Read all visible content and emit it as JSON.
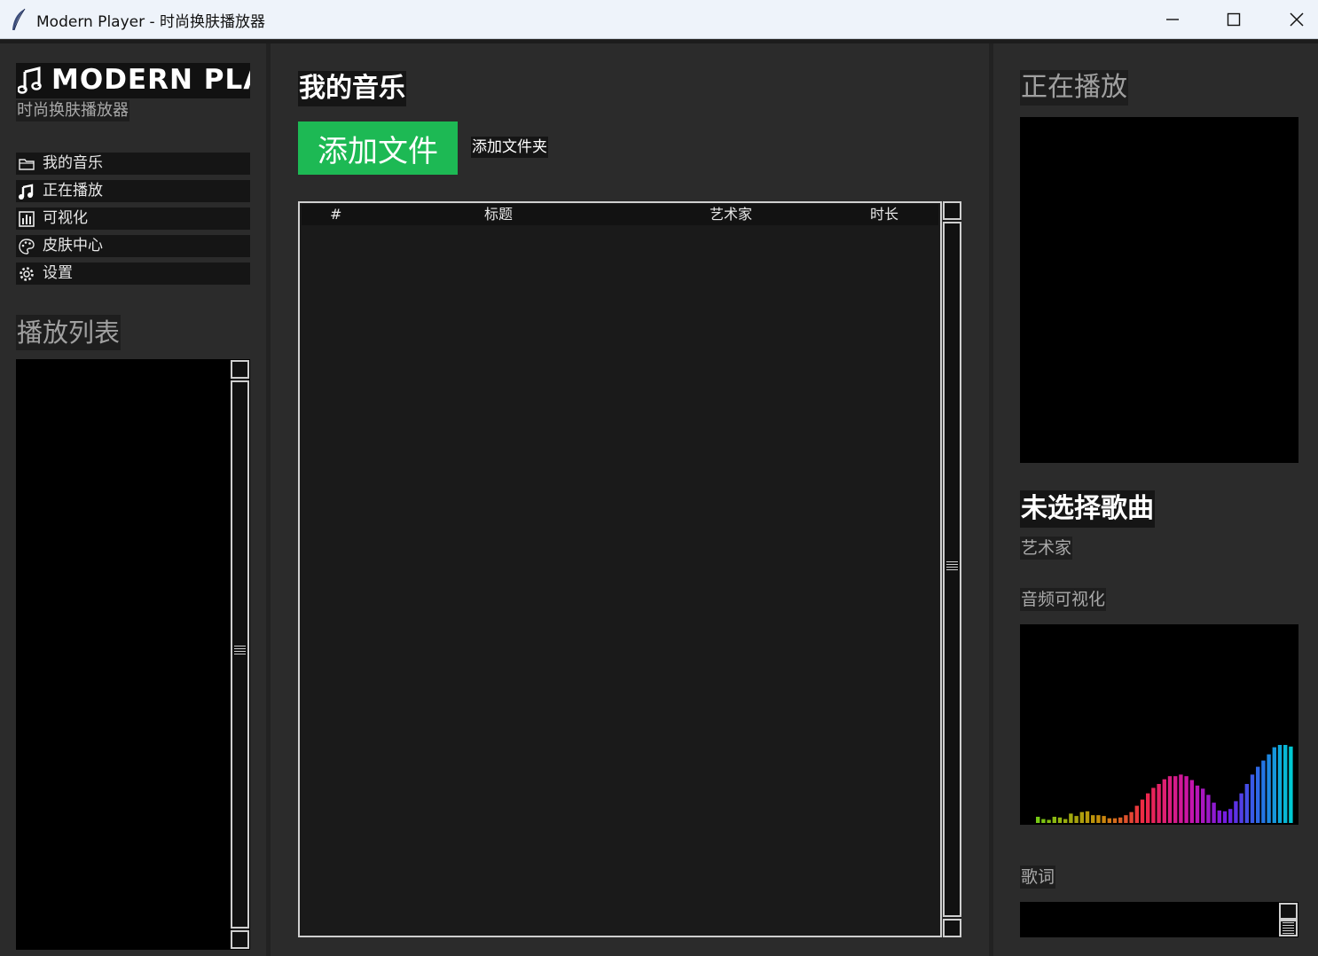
{
  "window": {
    "title": "Modern Player - 时尚换肤播放器",
    "icon": "feather-icon",
    "controls": [
      "minimize-icon",
      "maximize-icon",
      "close-icon"
    ]
  },
  "sidebar": {
    "brand": "MODERN PLAYER",
    "subtitle": "时尚换肤播放器",
    "nav": [
      {
        "label": "我的音乐",
        "icon": "folder-icon"
      },
      {
        "label": "正在播放",
        "icon": "music-note-icon"
      },
      {
        "label": "可视化",
        "icon": "bar-chart-icon"
      },
      {
        "label": "皮肤中心",
        "icon": "palette-icon"
      },
      {
        "label": "设置",
        "icon": "gear-icon"
      }
    ],
    "playlist_title": "播放列表"
  },
  "center": {
    "title": "我的音乐",
    "add_file": "添加文件",
    "add_folder": "添加文件夹",
    "columns": [
      "#",
      "标题",
      "艺术家",
      "时长"
    ]
  },
  "right": {
    "now_playing_title": "正在播放",
    "song_title": "未选择歌曲",
    "artist": "艺术家",
    "visualizer_label": "音频可视化",
    "lyrics_label": "歌词",
    "spectrum_levels": [
      0.08,
      0.05,
      0.04,
      0.08,
      0.07,
      0.05,
      0.12,
      0.09,
      0.14,
      0.15,
      0.1,
      0.1,
      0.09,
      0.06,
      0.06,
      0.07,
      0.1,
      0.14,
      0.22,
      0.3,
      0.38,
      0.45,
      0.5,
      0.56,
      0.6,
      0.6,
      0.62,
      0.6,
      0.55,
      0.48,
      0.44,
      0.36,
      0.26,
      0.16,
      0.15,
      0.18,
      0.28,
      0.38,
      0.5,
      0.62,
      0.72,
      0.8,
      0.88,
      0.97,
      1.0,
      1.0,
      0.98
    ]
  },
  "colors": {
    "accent": "#1db954",
    "panel": "#2b2b2b",
    "background": "#222222"
  }
}
